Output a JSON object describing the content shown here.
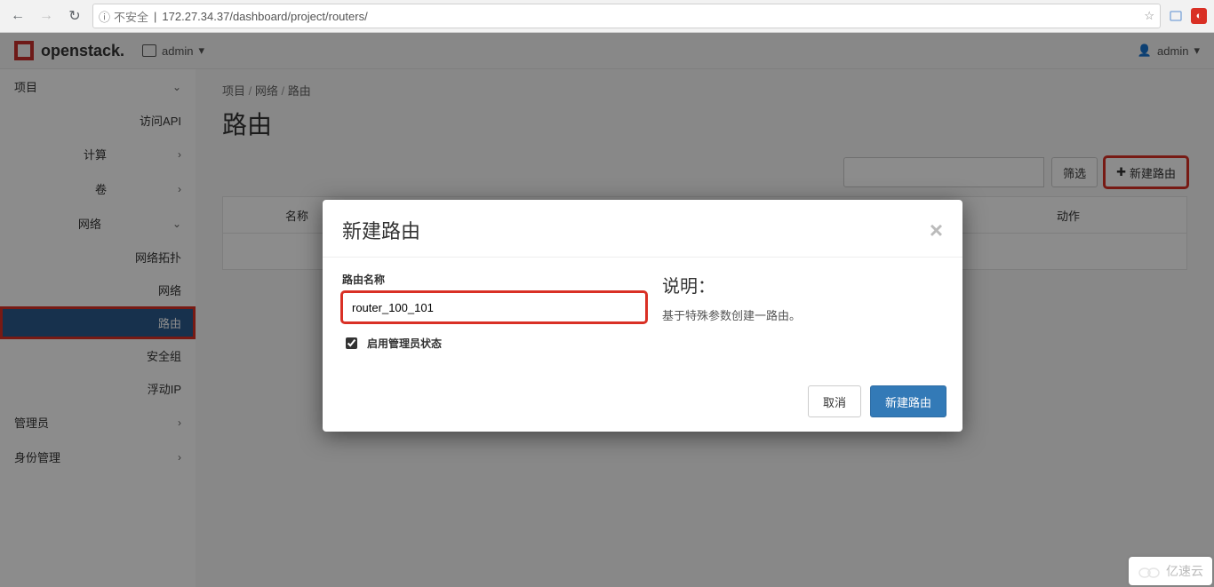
{
  "browser": {
    "insecure_label": "不安全",
    "url": "172.27.34.37/dashboard/project/routers/"
  },
  "header": {
    "brand": "openstack.",
    "project_switcher": "admin",
    "user_menu": "admin"
  },
  "sidebar": {
    "level1_project": "项目",
    "api_access": "访问API",
    "compute": "计算",
    "volumes": "卷",
    "network": "网络",
    "network_children": {
      "topology": "网络拓扑",
      "networks": "网络",
      "routers": "路由",
      "security_groups": "安全组",
      "floating_ips": "浮动IP"
    },
    "admin": "管理员",
    "identity": "身份管理"
  },
  "breadcrumbs": {
    "a": "项目",
    "b": "网络",
    "c": "路由"
  },
  "page_title": "路由",
  "toolbar": {
    "filter_label": "筛选",
    "create_label": "新建路由"
  },
  "table": {
    "col_name": "名称",
    "col_action": "动作"
  },
  "modal": {
    "title": "新建路由",
    "name_label": "路由名称",
    "name_value": "router_100_101",
    "admin_state_label": "启用管理员状态",
    "help_title": "说明：",
    "help_text": "基于特殊参数创建一路由。",
    "cancel": "取消",
    "submit": "新建路由"
  },
  "watermark": "亿速云"
}
